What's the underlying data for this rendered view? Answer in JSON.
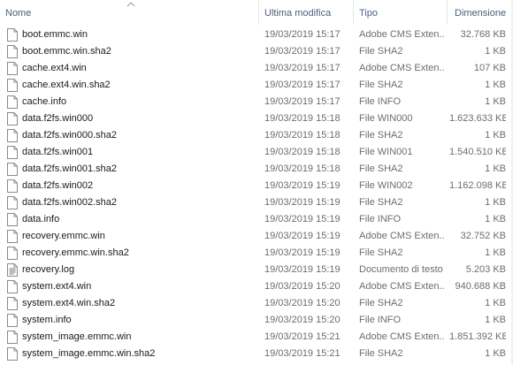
{
  "columns": {
    "name": "Nome",
    "modified": "Ultima modifica",
    "type": "Tipo",
    "size": "Dimensione"
  },
  "files": [
    {
      "name": "boot.emmc.win",
      "modified": "19/03/2019 15:17",
      "type": "Adobe CMS Exten...",
      "size": "32.768 KB",
      "icon": "file-icon"
    },
    {
      "name": "boot.emmc.win.sha2",
      "modified": "19/03/2019 15:17",
      "type": "File SHA2",
      "size": "1 KB",
      "icon": "file-icon"
    },
    {
      "name": "cache.ext4.win",
      "modified": "19/03/2019 15:17",
      "type": "Adobe CMS Exten...",
      "size": "107 KB",
      "icon": "file-icon"
    },
    {
      "name": "cache.ext4.win.sha2",
      "modified": "19/03/2019 15:17",
      "type": "File SHA2",
      "size": "1 KB",
      "icon": "file-icon"
    },
    {
      "name": "cache.info",
      "modified": "19/03/2019 15:17",
      "type": "File INFO",
      "size": "1 KB",
      "icon": "file-icon"
    },
    {
      "name": "data.f2fs.win000",
      "modified": "19/03/2019 15:18",
      "type": "File WIN000",
      "size": "1.623.633 KB",
      "icon": "file-icon"
    },
    {
      "name": "data.f2fs.win000.sha2",
      "modified": "19/03/2019 15:18",
      "type": "File SHA2",
      "size": "1 KB",
      "icon": "file-icon"
    },
    {
      "name": "data.f2fs.win001",
      "modified": "19/03/2019 15:18",
      "type": "File WIN001",
      "size": "1.540.510 KB",
      "icon": "file-icon"
    },
    {
      "name": "data.f2fs.win001.sha2",
      "modified": "19/03/2019 15:18",
      "type": "File SHA2",
      "size": "1 KB",
      "icon": "file-icon"
    },
    {
      "name": "data.f2fs.win002",
      "modified": "19/03/2019 15:19",
      "type": "File WIN002",
      "size": "1.162.098 KB",
      "icon": "file-icon"
    },
    {
      "name": "data.f2fs.win002.sha2",
      "modified": "19/03/2019 15:19",
      "type": "File SHA2",
      "size": "1 KB",
      "icon": "file-icon"
    },
    {
      "name": "data.info",
      "modified": "19/03/2019 15:19",
      "type": "File INFO",
      "size": "1 KB",
      "icon": "file-icon"
    },
    {
      "name": "recovery.emmc.win",
      "modified": "19/03/2019 15:19",
      "type": "Adobe CMS Exten...",
      "size": "32.752 KB",
      "icon": "file-icon"
    },
    {
      "name": "recovery.emmc.win.sha2",
      "modified": "19/03/2019 15:19",
      "type": "File SHA2",
      "size": "1 KB",
      "icon": "file-icon"
    },
    {
      "name": "recovery.log",
      "modified": "19/03/2019 15:19",
      "type": "Documento di testo",
      "size": "5.203 KB",
      "icon": "text-document-icon"
    },
    {
      "name": "system.ext4.win",
      "modified": "19/03/2019 15:20",
      "type": "Adobe CMS Exten...",
      "size": "940.688 KB",
      "icon": "file-icon"
    },
    {
      "name": "system.ext4.win.sha2",
      "modified": "19/03/2019 15:20",
      "type": "File SHA2",
      "size": "1 KB",
      "icon": "file-icon"
    },
    {
      "name": "system.info",
      "modified": "19/03/2019 15:20",
      "type": "File INFO",
      "size": "1 KB",
      "icon": "file-icon"
    },
    {
      "name": "system_image.emmc.win",
      "modified": "19/03/2019 15:21",
      "type": "Adobe CMS Exten...",
      "size": "1.851.392 KB",
      "icon": "file-icon"
    },
    {
      "name": "system_image.emmc.win.sha2",
      "modified": "19/03/2019 15:21",
      "type": "File SHA2",
      "size": "1 KB",
      "icon": "file-icon"
    }
  ],
  "colors": {
    "header_text": "#4c607a",
    "name_text": "#1a1a1a",
    "detail_text": "#6d6d6d",
    "separator": "#e5e5e5"
  }
}
